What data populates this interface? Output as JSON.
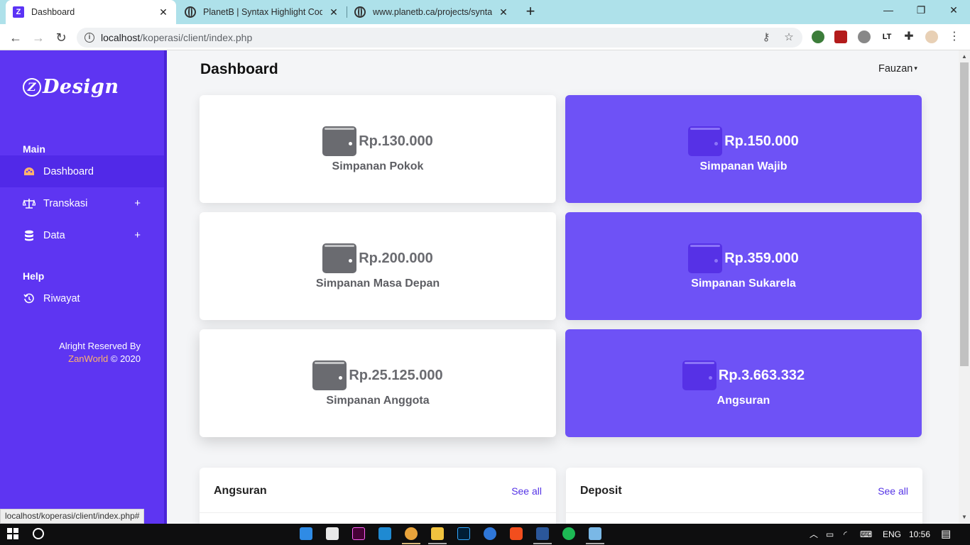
{
  "browser": {
    "tabs": [
      {
        "title": "Dashboard",
        "favicon": "z-design-icon"
      },
      {
        "title": "PlanetB | Syntax Highlight Code i",
        "favicon": "globe-icon"
      },
      {
        "title": "www.planetb.ca/projects/syntaxH",
        "favicon": "globe-icon"
      }
    ],
    "url_host": "localhost",
    "url_path": "/koperasi/client/index.php",
    "status_url": "localhost/koperasi/client/index.php#"
  },
  "sidebar": {
    "logo_mark": "Z",
    "logo_text": "Design",
    "sections": {
      "main": "Main",
      "help": "Help"
    },
    "items": [
      {
        "label": "Dashboard",
        "icon": "palette-icon"
      },
      {
        "label": "Transkasi",
        "icon": "scale-icon",
        "expander": "+"
      },
      {
        "label": "Data",
        "icon": "database-icon",
        "expander": "+"
      },
      {
        "label": "Riwayat",
        "icon": "history-icon"
      }
    ],
    "footer_line1": "Alright Reserved By",
    "footer_brand": "ZanWorld",
    "footer_year": " © 2020"
  },
  "header": {
    "title": "Dashboard",
    "user": "Fauzan",
    "caret": "▾"
  },
  "cards": [
    {
      "amount": "Rp.130.000",
      "label": "Simpanan Pokok"
    },
    {
      "amount": "Rp.150.000",
      "label": "Simpanan Wajib"
    },
    {
      "amount": "Rp.200.000",
      "label": "Simpanan Masa Depan"
    },
    {
      "amount": "Rp.359.000",
      "label": "Simpanan Sukarela"
    },
    {
      "amount": "Rp.25.125.000",
      "label": "Simpanan Anggota"
    },
    {
      "amount": "Rp.3.663.332",
      "label": "Angsuran"
    }
  ],
  "panels": [
    {
      "title": "Angsuran",
      "link": "See all"
    },
    {
      "title": "Deposit",
      "link": "See all"
    }
  ],
  "taskbar": {
    "language": "ENG",
    "time": "10:56"
  },
  "colors": {
    "sidebar": "#5e35f2",
    "card_purple": "#6e52f6",
    "accent_link": "#5534e6",
    "brand_orange": "#ffb36b"
  }
}
